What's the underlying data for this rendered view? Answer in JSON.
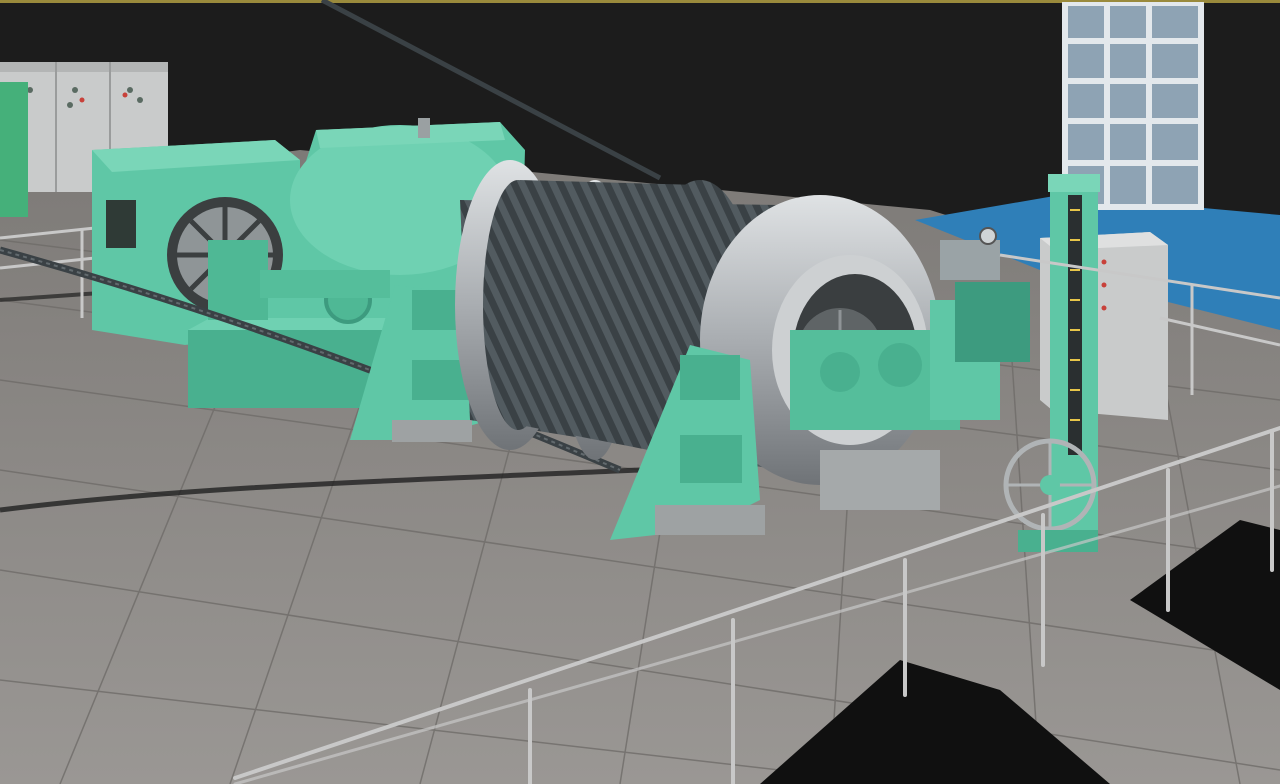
{
  "scene": {
    "subject": "mine-hoist-winch",
    "colors": {
      "background": "#1c1c1c",
      "top_border": "#9a8a3c",
      "floor": "#8a8784",
      "floor_tile_line": "#6f6c69",
      "machine_green": "#5fc7a6",
      "machine_green_dark": "#3d9b7f",
      "drum_steel": "#b9bcbf",
      "rope": "#3a4145",
      "cabinet_grey": "#c9cbcb",
      "water_blue": "#2f7fb8",
      "window_pane": "#8ea3b4",
      "railing": "#c8c8c8",
      "shadow": "#101010"
    }
  }
}
